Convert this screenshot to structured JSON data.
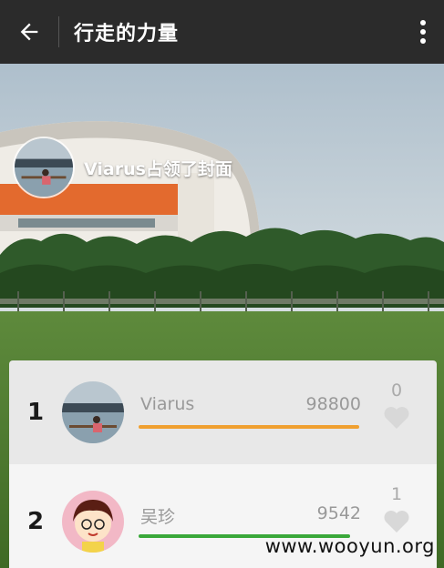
{
  "app": {
    "title": "行走的力量"
  },
  "cover": {
    "owner_text": "Viarus占领了封面"
  },
  "ranking": [
    {
      "rank": "1",
      "name": "Viarus",
      "steps": "98800",
      "likes": "0",
      "progress": 0.99,
      "bar_color": "#f0a030"
    },
    {
      "rank": "2",
      "name": "吴珍",
      "steps": "9542",
      "likes": "1",
      "progress": 0.95,
      "bar_color": "#3aa83a"
    }
  ],
  "watermark": "www.wooyun.org",
  "icons": {
    "back": "back-arrow-icon",
    "more": "more-vertical-icon",
    "like": "heart-icon"
  }
}
